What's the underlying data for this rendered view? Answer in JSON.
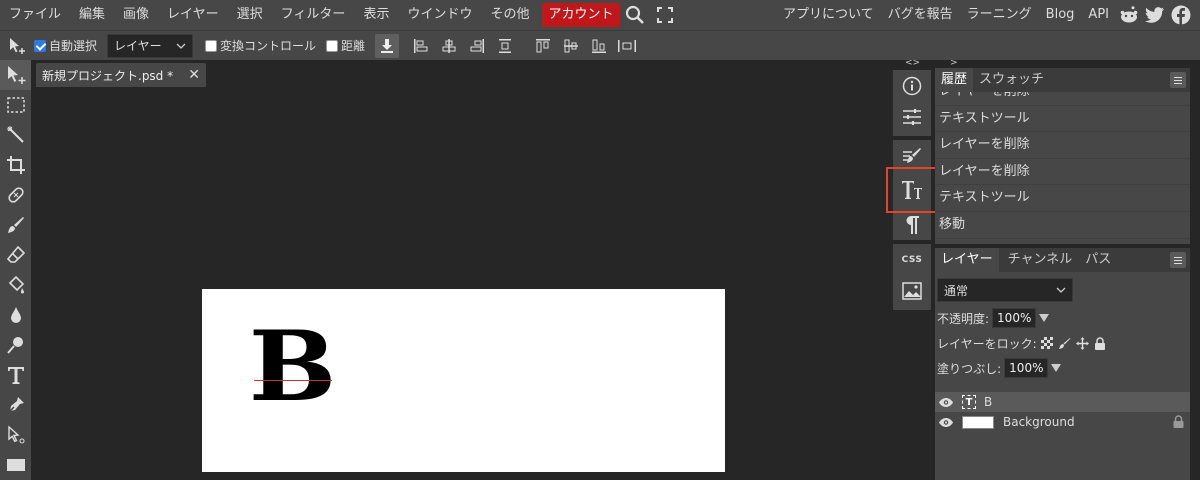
{
  "menubar": {
    "items": [
      "ファイル",
      "編集",
      "画像",
      "レイヤー",
      "選択",
      "フィルター",
      "表示",
      "ウインドウ",
      "その他"
    ],
    "account": "アカウント",
    "right_items": [
      "アプリについて",
      "バグを報告",
      "ラーニング",
      "Blog",
      "API"
    ],
    "icons": [
      "search-icon",
      "fullscreen-icon",
      "reddit-icon",
      "twitter-icon",
      "facebook-icon"
    ]
  },
  "options": {
    "auto_select_label": "自動選択",
    "auto_select_checked": true,
    "target_select": "レイヤー",
    "transform_label": "変換コントロール",
    "distance_label": "距離"
  },
  "tab": {
    "title": "新規プロジェクト.psd *",
    "close": "✕"
  },
  "canvas": {
    "text": "B"
  },
  "history": {
    "tabs": [
      "履歴",
      "スウォッチ"
    ],
    "items": [
      "レイヤーを削除",
      "テキストツール",
      "レイヤーを削除",
      "レイヤーを削除",
      "テキストツール",
      "移動"
    ]
  },
  "layers": {
    "tabs": [
      "レイヤー",
      "チャンネル",
      "パス"
    ],
    "blend_mode": "通常",
    "opacity_label": "不透明度:",
    "opacity_value": "100%",
    "lock_label": "レイヤーをロック:",
    "fill_label": "塗りつぶし:",
    "fill_value": "100%",
    "items": [
      {
        "name": "B",
        "type": "text"
      },
      {
        "name": "Background",
        "type": "image"
      }
    ]
  },
  "side_panel": {
    "css_label": "CSS",
    "grip_left": "<>",
    "grip_right": "><"
  },
  "colors": {
    "account_red": "#c0181a",
    "highlight": "#e0452b",
    "panel": "#474747",
    "workspace": "#262626"
  }
}
